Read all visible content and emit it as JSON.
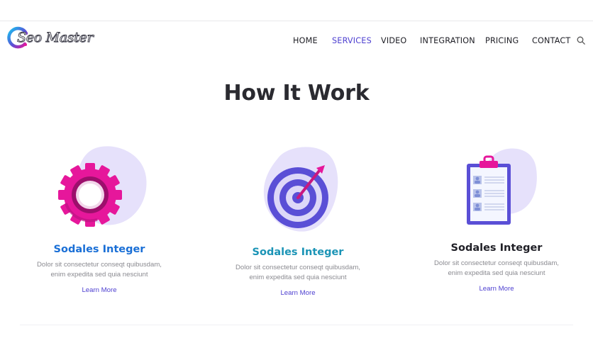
{
  "brand": {
    "name": "Seo Master"
  },
  "nav": {
    "items": [
      {
        "label": "HOME",
        "active": false
      },
      {
        "label": "SERVICES",
        "active": true
      },
      {
        "label": "VIDEO",
        "active": false
      },
      {
        "label": "INTEGRATION",
        "active": false
      },
      {
        "label": "PRICING",
        "active": false
      },
      {
        "label": "CONTACT",
        "active": false
      }
    ],
    "search_icon": "search-icon"
  },
  "section": {
    "title": "How It Work"
  },
  "cards": [
    {
      "icon": "gear-icon",
      "title": "Sodales Integer",
      "title_color": "#1a6fd6",
      "desc_line1": "Dolor sit consectetur conseqt quibusdam,",
      "desc_line2": "enim expedita sed quia nesciunt",
      "link": "Learn More"
    },
    {
      "icon": "target-icon",
      "title": "Sodales Integer",
      "title_color": "#1b94b6",
      "desc_line1": "Dolor sit consectetur conseqt quibusdam,",
      "desc_line2": "enim expedita sed quia nesciunt",
      "link": "Learn More"
    },
    {
      "icon": "clipboard-icon",
      "title": "Sodales Integer",
      "title_color": "#1f1f26",
      "desc_line1": "Dolor sit consectetur conseqt quibusdam,",
      "desc_line2": "enim expedita sed quia nesciunt",
      "link": "Learn More"
    }
  ],
  "colors": {
    "accent": "#4d3fd0",
    "blob": "#e6e1fb",
    "pink": "#e6179b",
    "indigo": "#5a4fd6"
  }
}
